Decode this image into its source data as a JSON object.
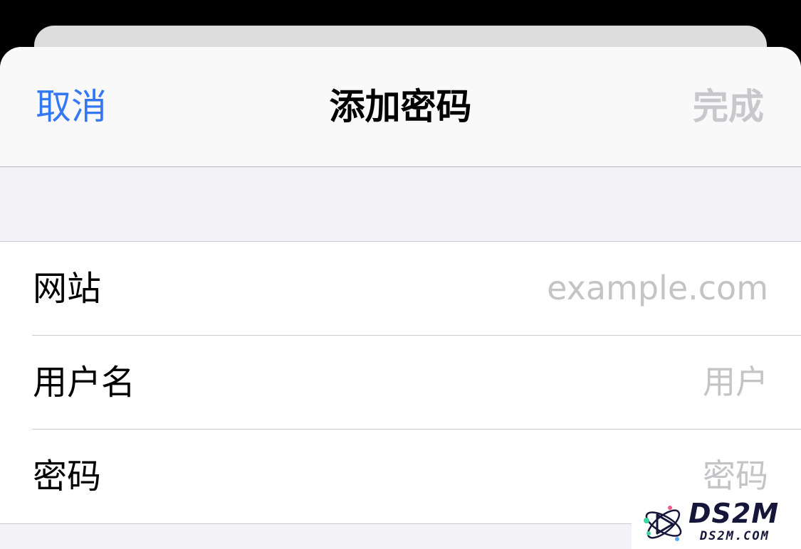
{
  "nav": {
    "cancel_label": "取消",
    "title": "添加密码",
    "done_label": "完成"
  },
  "form": {
    "rows": [
      {
        "label": "网站",
        "placeholder": "example.com"
      },
      {
        "label": "用户名",
        "placeholder": "用户"
      },
      {
        "label": "密码",
        "placeholder": "密码"
      }
    ]
  },
  "watermark": {
    "title": "DS2M",
    "subtitle": "DS2M.COM"
  },
  "colors": {
    "accent": "#3478f6",
    "disabled": "#c7c7cc",
    "placeholder": "#c4c4c6",
    "grouped_background": "#f2f2f7"
  }
}
